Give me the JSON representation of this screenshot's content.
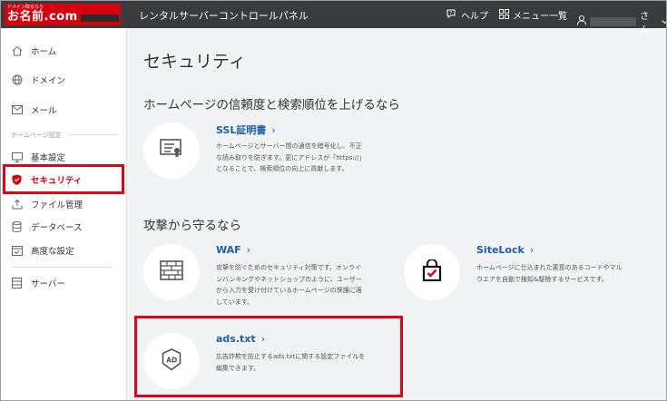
{
  "header": {
    "logo_tagline": "ドメイン取るなら",
    "logo_text": "お名前.com",
    "app_title": "レンタルサーバーコントロールパネル",
    "help_label": "ヘルプ",
    "menu_label": "メニュー一覧",
    "user_suffix": "さん"
  },
  "sidebar": {
    "section_label": "ホームページ設定",
    "items": [
      {
        "label": "ホーム",
        "icon": "home-icon"
      },
      {
        "label": "ドメイン",
        "icon": "globe-icon"
      },
      {
        "label": "メール",
        "icon": "mail-icon"
      },
      {
        "label": "基本設定",
        "icon": "monitor-icon"
      },
      {
        "label": "セキュリティ",
        "icon": "shield-icon",
        "active": true
      },
      {
        "label": "ファイル管理",
        "icon": "upload-icon"
      },
      {
        "label": "データベース",
        "icon": "database-icon"
      },
      {
        "label": "高度な設定",
        "icon": "settings-window-icon"
      },
      {
        "label": "サーバー",
        "icon": "server-icon"
      }
    ]
  },
  "main": {
    "title": "セキュリティ",
    "section1_heading": "ホームページの信頼度と検索順位を上げるなら",
    "section2_heading": "攻撃から守るなら",
    "cards": {
      "ssl": {
        "title": "SSL証明書",
        "desc_lines": [
          "ホームページとサーバー間の通信を暗号化し、不正",
          "な読み取りを防ぎます。更にアドレスが「https://」",
          "となることで、検索順位の向上に貢献します。"
        ]
      },
      "waf": {
        "title": "WAF",
        "desc_lines": [
          "攻撃を防ぐためのセキュリティ対策です。オンライ",
          "ンバンキングやネットショップのように、ユーザー",
          "から入力を受け付けているホームページの保護に適",
          "しています。"
        ]
      },
      "sitelock": {
        "title": "SiteLock",
        "desc_lines": [
          "ホームページに仕込まれた悪意のあるコードやマル",
          "ウエアを自動で検知&駆除するサービスです。"
        ]
      },
      "ads": {
        "title": "ads.txt",
        "desc_lines": [
          "広告詐欺を防止するads.txtに関する設定ファイルを",
          "編集できます。"
        ]
      }
    },
    "chevron": "›"
  },
  "colors": {
    "topbar": "#3a3b3d",
    "brand_red": "#d7000f",
    "highlight": "#e60012",
    "link_blue": "#1c5fae"
  }
}
